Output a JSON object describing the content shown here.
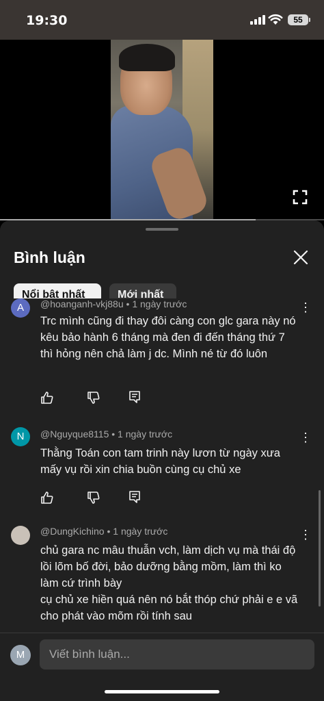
{
  "status_bar": {
    "time": "19:30",
    "battery": "55"
  },
  "video": {
    "progress_fraction": 0.79
  },
  "comments_sheet": {
    "title": "Bình luận",
    "chips": [
      "Nổi bật nhất",
      "Mới nhất"
    ],
    "comments": [
      {
        "avatar_letter": "A",
        "avatar_color": "#5c6bc0",
        "author": "@hoanganh-vkj88u",
        "time": "1 ngày trước",
        "text": "Trc mình cũng đi thay đôi càng con glc gara này nó kêu bảo hành 6 tháng mà đen đi đến tháng thứ 7 thì hỏng nên chả làm j dc. Mình né từ đó luôn"
      },
      {
        "avatar_letter": "N",
        "avatar_color": "#0097a7",
        "author": "@Nguyque8115",
        "time": "1 ngày trước",
        "text": "Thằng Toán con tam trinh này lươn từ ngày xưa mấy vụ rồi xin chia buồn cùng cụ chủ xe"
      },
      {
        "avatar_letter": "",
        "avatar_color": "#c9c1b8",
        "author": "@DungKichino",
        "time": "1 ngày trước",
        "text": "chủ gara nc mâu thuẫn vch, làm dịch vụ mà thái độ lồi lõm bố đời, bảo dưỡng bằng mồm, làm thì ko làm cứ trình bày\ncụ chủ xe hiền quá nên nó bắt thóp chứ phải e e vã cho phát vào mõm rồi tính sau"
      }
    ],
    "separator": "•"
  },
  "composer": {
    "avatar_letter": "M",
    "placeholder": "Viết bình luận..."
  }
}
